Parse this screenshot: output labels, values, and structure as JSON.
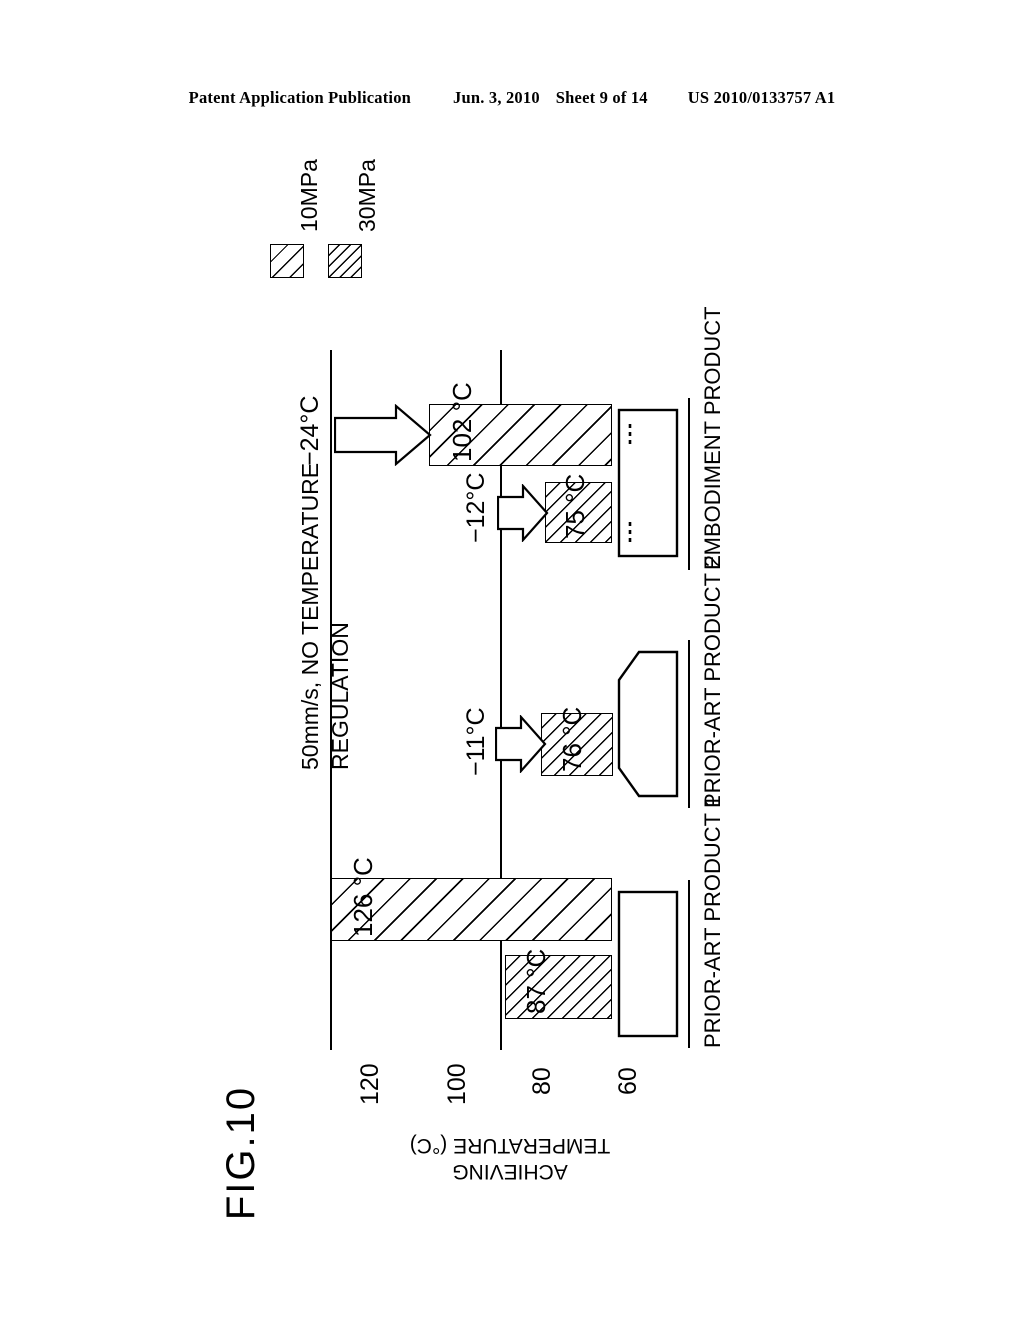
{
  "header": {
    "publication": "Patent Application Publication",
    "date": "Jun. 3, 2010",
    "sheet": "Sheet 9 of 14",
    "number": "US 2010/0133757 A1"
  },
  "figure": {
    "label": "FIG.10"
  },
  "legend": {
    "items": [
      {
        "label": "10MPa",
        "pattern": "sparse-diagonal-hatch"
      },
      {
        "label": "30MPa",
        "pattern": "dense-diagonal-hatch"
      }
    ]
  },
  "caption": {
    "condition": "50mm/s, NO TEMPERATURE\n      REGULATION"
  },
  "axis": {
    "title": "ACHIEVING\nTEMPERATURE (°C)",
    "ticks": [
      "120",
      "100",
      "80",
      "60"
    ]
  },
  "categories": [
    {
      "id": "embodiment-product",
      "label": "EMBODIMENT\nPRODUCT",
      "shape": "rectangle-with-dashes"
    },
    {
      "id": "prior-art-product-2",
      "label": "PRIOR-ART\nPRODUCT 2",
      "shape": "chamfered-block"
    },
    {
      "id": "prior-art-product-1",
      "label": "PRIOR-ART\nPRODUCT 1",
      "shape": "rectangle"
    }
  ],
  "annotations": [
    {
      "id": "delta-embodiment-10mpa",
      "text": "−24°C"
    },
    {
      "id": "delta-embodiment-30mpa",
      "text": "−12°C"
    },
    {
      "id": "delta-prior-art-2-30mpa",
      "text": "−11°C"
    }
  ],
  "bar_labels": {
    "embodiment_10mpa": "102 °C",
    "embodiment_30mpa": "75 °C",
    "prior_art_2_30mpa": "76 °C",
    "prior_art_1_10mpa": "126 °C",
    "prior_art_1_30mpa": "87 °C"
  },
  "chart_data": {
    "type": "bar",
    "title": "FIG.10",
    "subtitle": "50mm/s, NO TEMPERATURE REGULATION",
    "orientation": "horizontal-rotated-90",
    "xlabel": "",
    "ylabel": "ACHIEVING TEMPERATURE (°C)",
    "ylim": [
      60,
      130
    ],
    "ticks": [
      120,
      100,
      80,
      60
    ],
    "grid": false,
    "legend_position": "top-left",
    "categories": [
      "EMBODIMENT PRODUCT",
      "PRIOR-ART PRODUCT 2",
      "PRIOR-ART PRODUCT 1"
    ],
    "series": [
      {
        "name": "10MPa",
        "values": [
          102,
          null,
          126
        ],
        "labels": [
          "102 °C",
          "",
          "126 °C"
        ]
      },
      {
        "name": "30MPa",
        "values": [
          75,
          76,
          87
        ],
        "labels": [
          "75 °C",
          "76 °C",
          "87 °C"
        ]
      }
    ],
    "annotations": [
      {
        "text": "−24°C",
        "refers_to": "EMBODIMENT PRODUCT 10MPa vs PRIOR-ART PRODUCT 1 10MPa"
      },
      {
        "text": "−12°C",
        "refers_to": "EMBODIMENT PRODUCT 30MPa vs PRIOR-ART PRODUCT 1 30MPa"
      },
      {
        "text": "−11°C",
        "refers_to": "PRIOR-ART PRODUCT 2 30MPa vs PRIOR-ART PRODUCT 1 30MPa"
      }
    ]
  }
}
